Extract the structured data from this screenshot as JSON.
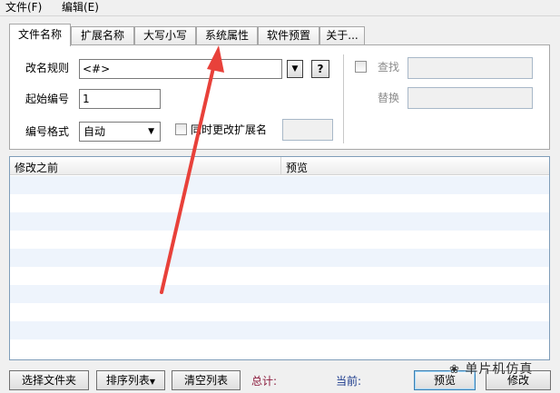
{
  "menu": [
    {
      "label": "文件(F)"
    },
    {
      "label": "编辑(E)"
    }
  ],
  "tabs": [
    {
      "label": "文件名称",
      "active": true
    },
    {
      "label": "扩展名称"
    },
    {
      "label": "大写小写"
    },
    {
      "label": "系统属性"
    },
    {
      "label": "软件预置"
    },
    {
      "label": "关于..."
    }
  ],
  "rename": {
    "rule_label": "改名规则",
    "rule_value": "<#>",
    "help_label": "?",
    "start_label": "起始编号",
    "start_value": "1",
    "format_label": "编号格式",
    "format_value": "自动",
    "change_ext_label": "同时更改扩展名",
    "change_ext_value": ""
  },
  "find_replace": {
    "find_label": "查找",
    "find_value": "",
    "replace_label": "替换",
    "replace_value": ""
  },
  "list": {
    "columns": [
      "修改之前",
      "预览"
    ]
  },
  "bottom": {
    "select_folder": "选择文件夹",
    "sort_list": "排序列表",
    "clear_list": "清空列表",
    "total_label": "总计:",
    "current_label": "当前:",
    "preview_button": "预览",
    "modify_button": "修改"
  },
  "watermark": "单片机仿真",
  "colors": {
    "annotation_arrow": "#e8413a",
    "status_total": "#8b1a3c",
    "status_current": "#1b3a8c"
  }
}
